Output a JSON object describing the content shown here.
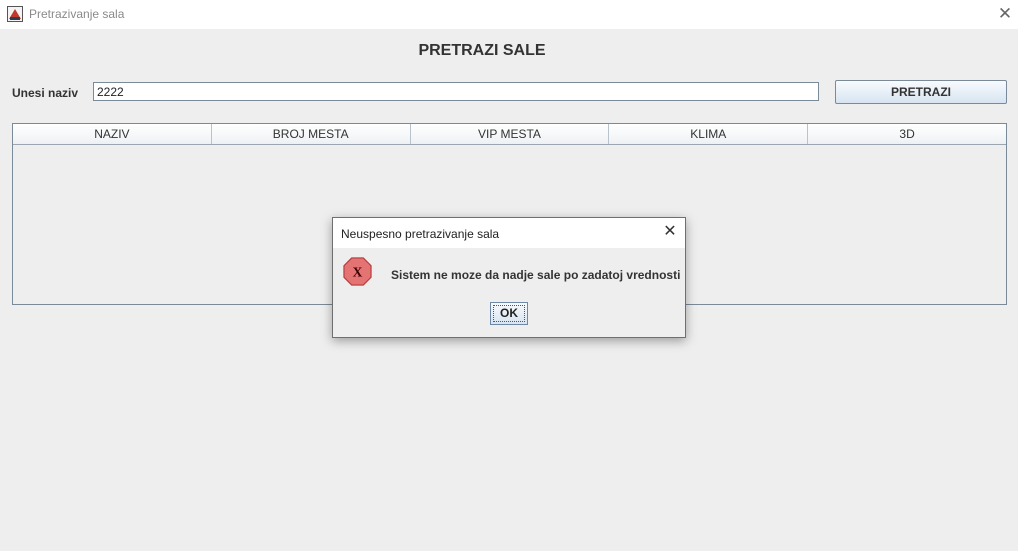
{
  "window": {
    "title": "Pretrazivanje sala",
    "close_glyph": "✕",
    "icon": "app-icon"
  },
  "form": {
    "heading": "PRETRAZI SALE",
    "naziv_label": "Unesi naziv",
    "naziv_value": "2222",
    "search_button": "PRETRAZI"
  },
  "table": {
    "columns": [
      "NAZIV",
      "BROJ MESTA",
      "VIP MESTA",
      "KLIMA",
      "3D"
    ],
    "rows": []
  },
  "dialog": {
    "title": "Neuspesno pretrazivanje sala",
    "message": "Sistem ne moze da nadje sale po zadatoj vrednosti",
    "ok_label": "OK",
    "close_glyph": "✕",
    "icon": "error-icon",
    "icon_glyph": "X"
  },
  "colors": {
    "error_red": "#e24b4b",
    "background": "#eeeeee"
  }
}
